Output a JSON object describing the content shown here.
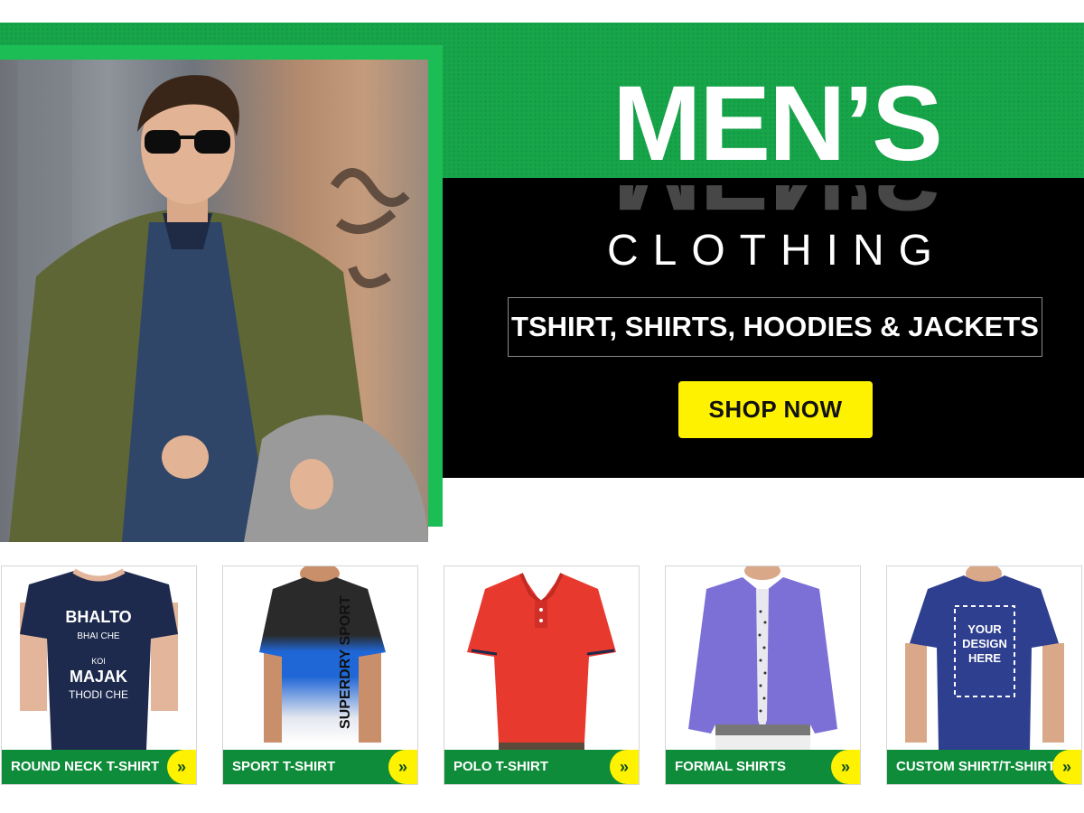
{
  "hero": {
    "title": "MEN’S",
    "subtitle": "CLOTHING",
    "categories_text": "TSHIRT, SHIRTS, HOODIES & JACKETS",
    "cta_label": "SHOP NOW"
  },
  "products": [
    {
      "label": "ROUND NECK T-SHIRT",
      "arrow": "»",
      "print_lines": [
        "BHALTO",
        "BHAI CHE",
        "KOI",
        "MAJAK",
        "THODI CHE"
      ]
    },
    {
      "label": "SPORT T-SHIRT",
      "arrow": "»",
      "print_text": "SUPERDRY SPORT"
    },
    {
      "label": "POLO T-SHIRT",
      "arrow": "»"
    },
    {
      "label": "FORMAL SHIRTS",
      "arrow": "»"
    },
    {
      "label": "CUSTOM SHIRT/T-SHIRT",
      "arrow": "»",
      "print_lines": [
        "YOUR",
        "DESIGN",
        "HERE"
      ]
    }
  ],
  "colors": {
    "green": "#17a54a",
    "bright_green": "#1dbd55",
    "bar_green": "#0e8c3a",
    "yellow": "#fff200",
    "black": "#000000"
  }
}
